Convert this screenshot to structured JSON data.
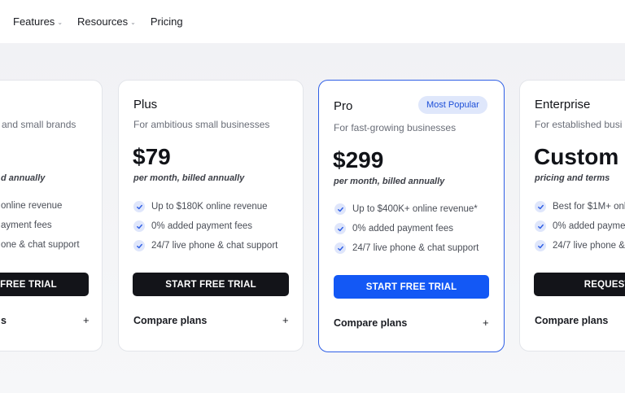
{
  "nav": {
    "items": [
      {
        "label": "Features"
      },
      {
        "label": "Resources"
      },
      {
        "label": "Pricing"
      }
    ]
  },
  "plans": [
    {
      "name": "",
      "subtitle": "and small brands",
      "price": "",
      "billing": "d annually",
      "features": [
        "online revenue",
        "ayment fees",
        "one & chat support"
      ],
      "cta": "FREE TRIAL",
      "compare": "s"
    },
    {
      "name": "Plus",
      "subtitle": "For ambitious small businesses",
      "price": "$79",
      "billing": "per month, billed annually",
      "features": [
        "Up to $180K online revenue",
        "0% added payment fees",
        "24/7 live phone & chat support"
      ],
      "cta": "START FREE TRIAL",
      "compare": "Compare plans"
    },
    {
      "name": "Pro",
      "badge": "Most Popular",
      "subtitle": "For fast-growing businesses",
      "price": "$299",
      "billing": "per month, billed annually",
      "features": [
        "Up to $400K+ online revenue*",
        "0% added payment fees",
        "24/7 live phone & chat support"
      ],
      "cta": "START FREE TRIAL",
      "compare": "Compare plans"
    },
    {
      "name": "Enterprise",
      "subtitle": "For established busi",
      "price": "Custom",
      "billing": "pricing and terms",
      "features": [
        "Best for $1M+ onl",
        "0% added payme",
        "24/7 live phone &"
      ],
      "cta": "REQUEST A",
      "compare": "Compare plans"
    }
  ],
  "icons": {
    "check": "check-icon",
    "expand": "plus-icon",
    "dropdown": "chevron-down-icon"
  },
  "colors": {
    "accent": "#1358f5",
    "dark_button": "#131419",
    "badge_bg": "#dfe7fb",
    "badge_text": "#1d4fd8"
  },
  "symbols": {
    "plus": "+",
    "caret": "⌄"
  }
}
